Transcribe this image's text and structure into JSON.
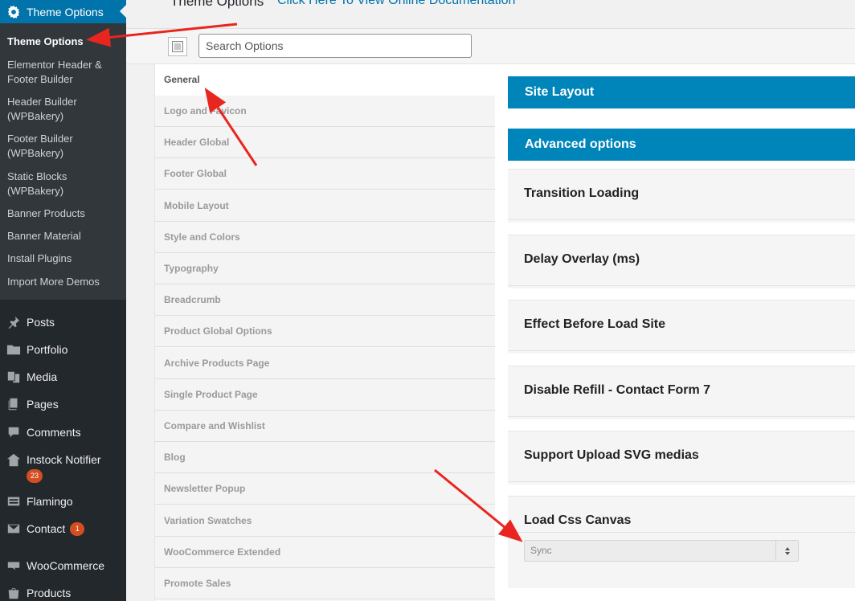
{
  "header": {
    "title": "Theme Options",
    "doc_link": "Click Here To View Online Documentation"
  },
  "toolbar": {
    "search_placeholder": "Search Options"
  },
  "admin_menu": {
    "theme_options_parent": "Theme Options",
    "submenu": [
      "Theme Options",
      "Elementor Header & Footer Builder",
      "Header Builder (WPBakery)",
      "Footer Builder (WPBakery)",
      "Static Blocks (WPBakery)",
      "Banner Products",
      "Banner Material",
      "Install Plugins",
      "Import More Demos"
    ],
    "items": [
      {
        "label": "Posts",
        "icon": "pin-icon"
      },
      {
        "label": "Portfolio",
        "icon": "folder-icon"
      },
      {
        "label": "Media",
        "icon": "media-icon"
      },
      {
        "label": "Pages",
        "icon": "pages-icon"
      },
      {
        "label": "Comments",
        "icon": "comments-icon"
      },
      {
        "label": "Instock Notifier",
        "icon": "instock-icon",
        "badge": "23"
      },
      {
        "label": "Flamingo",
        "icon": "flamingo-icon"
      },
      {
        "label": "Contact",
        "icon": "mail-icon",
        "badge": "1"
      },
      {
        "label": "WooCommerce",
        "icon": "woocommerce-icon"
      },
      {
        "label": "Products",
        "icon": "products-icon"
      }
    ]
  },
  "tabs": [
    "General",
    "Logo and Favicon",
    "Header Global",
    "Footer Global",
    "Mobile Layout",
    "Style and Colors",
    "Typography",
    "Breadcrumb",
    "Product Global Options",
    "Archive Products Page",
    "Single Product Page",
    "Compare and Wishlist",
    "Blog",
    "Newsletter Popup",
    "Variation Swatches",
    "WooCommerce Extended",
    "Promote Sales"
  ],
  "content": {
    "sections": [
      "Site Layout",
      "Advanced options"
    ],
    "options": [
      "Transition Loading",
      "Delay Overlay (ms)",
      "Effect Before Load Site",
      "Disable Refill - Contact Form 7",
      "Support Upload SVG medias",
      "Load Css Canvas"
    ],
    "load_css_canvas_value": "Sync"
  },
  "colors": {
    "admin_bg": "#23282d",
    "admin_active": "#0073aa",
    "section_bar": "#0085ba",
    "annotation": "#e8261f"
  }
}
